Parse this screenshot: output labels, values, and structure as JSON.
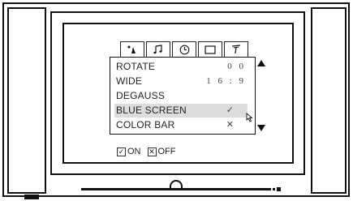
{
  "tabs": [
    {
      "icon": "picture-icon",
      "active": false
    },
    {
      "icon": "music-note-icon",
      "active": false
    },
    {
      "icon": "clock-icon",
      "active": false
    },
    {
      "icon": "screen-icon",
      "active": true
    },
    {
      "icon": "antenna-icon",
      "active": false
    }
  ],
  "menu": {
    "items": [
      {
        "label": "ROTATE",
        "value": "0 0"
      },
      {
        "label": "WIDE",
        "value": "1 6 : 9"
      },
      {
        "label": "DEGAUSS",
        "value": ""
      },
      {
        "label": "BLUE SCREEN",
        "value": "✓",
        "highlighted": true
      },
      {
        "label": "COLOR BAR",
        "value": "✕"
      }
    ]
  },
  "legend": {
    "on_symbol": "✓",
    "on_label": "ON",
    "off_symbol": "✕",
    "off_label": "OFF"
  },
  "colors": {
    "line": "#111111",
    "highlight": "#dcdcdc"
  }
}
